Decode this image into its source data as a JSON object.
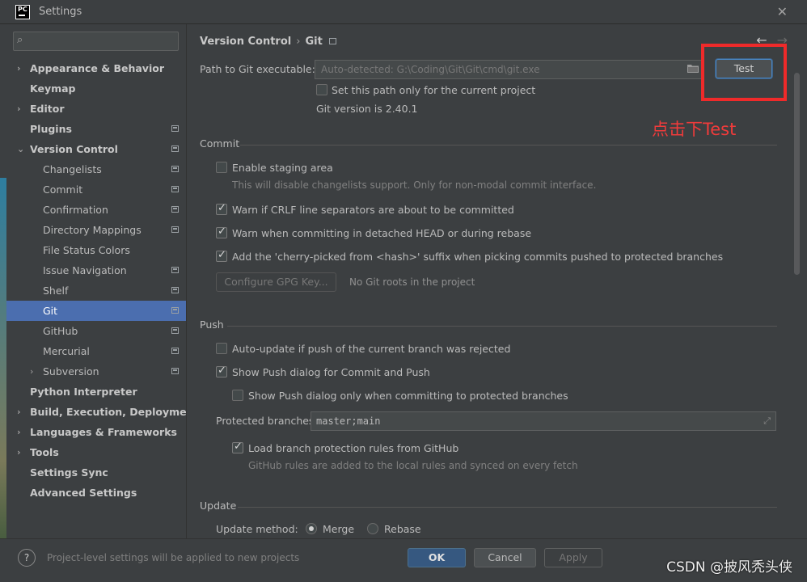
{
  "window": {
    "title": "Settings",
    "app_logo": "PC"
  },
  "search": {
    "placeholder": ""
  },
  "sidebar": {
    "items": [
      {
        "label": "Appearance & Behavior"
      },
      {
        "label": "Keymap"
      },
      {
        "label": "Editor"
      },
      {
        "label": "Plugins"
      },
      {
        "label": "Version Control"
      },
      {
        "label": "Changelists"
      },
      {
        "label": "Commit"
      },
      {
        "label": "Confirmation"
      },
      {
        "label": "Directory Mappings"
      },
      {
        "label": "File Status Colors"
      },
      {
        "label": "Issue Navigation"
      },
      {
        "label": "Shelf"
      },
      {
        "label": "Git"
      },
      {
        "label": "GitHub"
      },
      {
        "label": "Mercurial"
      },
      {
        "label": "Subversion"
      },
      {
        "label": "Python Interpreter"
      },
      {
        "label": "Build, Execution, Deployment"
      },
      {
        "label": "Languages & Frameworks"
      },
      {
        "label": "Tools"
      },
      {
        "label": "Settings Sync"
      },
      {
        "label": "Advanced Settings"
      }
    ]
  },
  "breadcrumb": {
    "parent": "Version Control",
    "current": "Git",
    "separator": "›"
  },
  "git": {
    "path_label": "Path to Git executable:",
    "path_value": "Auto-detected: G:\\Coding\\Git\\Git\\cmd\\git.exe",
    "test_button": "Test",
    "current_project_only": "Set this path only for the current project",
    "version_text": "Git version is 2.40.1",
    "annotation": "点击下Test"
  },
  "commit": {
    "title": "Commit",
    "staging_label": "Enable staging area",
    "staging_hint": "This will disable changelists support. Only for non-modal commit interface.",
    "crlf_label": "Warn if CRLF line separators are about to be committed",
    "detached_label": "Warn when committing in detached HEAD or during rebase",
    "cherry_label": "Add the 'cherry-picked from <hash>' suffix when picking commits pushed to protected branches",
    "gpg_button": "Configure GPG Key...",
    "gpg_note": "No Git roots in the project"
  },
  "push": {
    "title": "Push",
    "auto_update_label": "Auto-update if push of the current branch was rejected",
    "show_push_label": "Show Push dialog for Commit and Push",
    "protected_only_label": "Show Push dialog only when committing to protected branches",
    "protected_label": "Protected branches:",
    "protected_value": "master;main",
    "github_rules_label": "Load branch protection rules from GitHub",
    "github_rules_hint": "GitHub rules are added to the local rules and synced on every fetch"
  },
  "update": {
    "title": "Update",
    "method_label": "Update method:",
    "merge": "Merge",
    "rebase": "Rebase"
  },
  "footer": {
    "note": "Project-level settings will be applied to new projects",
    "ok": "OK",
    "cancel": "Cancel",
    "apply": "Apply",
    "watermark": "CSDN @披风秃头侠"
  },
  "colors": {
    "selection": "#4b6eaf",
    "annotation_red": "#ef2a2a",
    "ok_blue": "#365880"
  }
}
